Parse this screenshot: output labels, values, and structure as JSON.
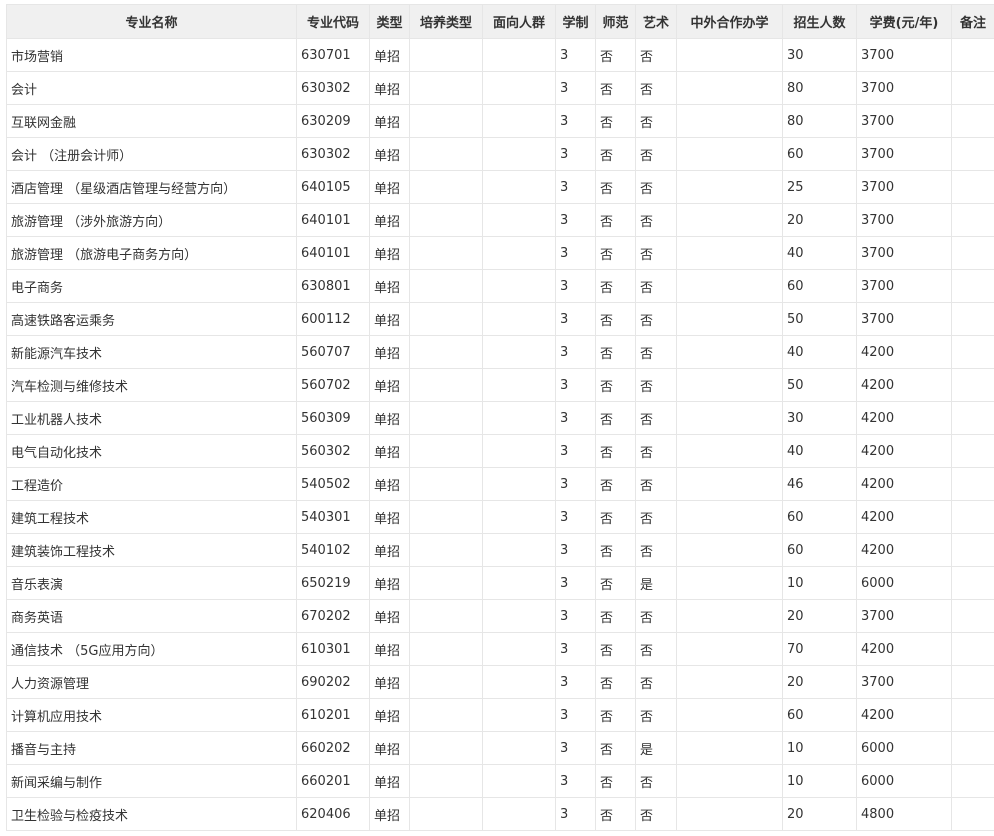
{
  "table": {
    "headers": [
      "专业名称",
      "专业代码",
      "类型",
      "培养类型",
      "面向人群",
      "学制",
      "师范",
      "艺术",
      "中外合作办学",
      "招生人数",
      "学费(元/年)",
      "备注"
    ],
    "rows": [
      [
        "市场营销",
        "630701",
        "单招",
        "",
        "",
        "3",
        "否",
        "否",
        "",
        "30",
        "3700",
        ""
      ],
      [
        "会计",
        "630302",
        "单招",
        "",
        "",
        "3",
        "否",
        "否",
        "",
        "80",
        "3700",
        ""
      ],
      [
        "互联网金融",
        "630209",
        "单招",
        "",
        "",
        "3",
        "否",
        "否",
        "",
        "80",
        "3700",
        ""
      ],
      [
        "会计 （注册会计师）",
        "630302",
        "单招",
        "",
        "",
        "3",
        "否",
        "否",
        "",
        "60",
        "3700",
        ""
      ],
      [
        "酒店管理 （星级酒店管理与经营方向）",
        "640105",
        "单招",
        "",
        "",
        "3",
        "否",
        "否",
        "",
        "25",
        "3700",
        ""
      ],
      [
        "旅游管理 （涉外旅游方向）",
        "640101",
        "单招",
        "",
        "",
        "3",
        "否",
        "否",
        "",
        "20",
        "3700",
        ""
      ],
      [
        "旅游管理 （旅游电子商务方向）",
        "640101",
        "单招",
        "",
        "",
        "3",
        "否",
        "否",
        "",
        "40",
        "3700",
        ""
      ],
      [
        "电子商务",
        "630801",
        "单招",
        "",
        "",
        "3",
        "否",
        "否",
        "",
        "60",
        "3700",
        ""
      ],
      [
        "高速铁路客运乘务",
        "600112",
        "单招",
        "",
        "",
        "3",
        "否",
        "否",
        "",
        "50",
        "3700",
        ""
      ],
      [
        "新能源汽车技术",
        "560707",
        "单招",
        "",
        "",
        "3",
        "否",
        "否",
        "",
        "40",
        "4200",
        ""
      ],
      [
        "汽车检测与维修技术",
        "560702",
        "单招",
        "",
        "",
        "3",
        "否",
        "否",
        "",
        "50",
        "4200",
        ""
      ],
      [
        "工业机器人技术",
        "560309",
        "单招",
        "",
        "",
        "3",
        "否",
        "否",
        "",
        "30",
        "4200",
        ""
      ],
      [
        "电气自动化技术",
        "560302",
        "单招",
        "",
        "",
        "3",
        "否",
        "否",
        "",
        "40",
        "4200",
        ""
      ],
      [
        "工程造价",
        "540502",
        "单招",
        "",
        "",
        "3",
        "否",
        "否",
        "",
        "46",
        "4200",
        ""
      ],
      [
        "建筑工程技术",
        "540301",
        "单招",
        "",
        "",
        "3",
        "否",
        "否",
        "",
        "60",
        "4200",
        ""
      ],
      [
        "建筑装饰工程技术",
        "540102",
        "单招",
        "",
        "",
        "3",
        "否",
        "否",
        "",
        "60",
        "4200",
        ""
      ],
      [
        "音乐表演",
        "650219",
        "单招",
        "",
        "",
        "3",
        "否",
        "是",
        "",
        "10",
        "6000",
        ""
      ],
      [
        "商务英语",
        "670202",
        "单招",
        "",
        "",
        "3",
        "否",
        "否",
        "",
        "20",
        "3700",
        ""
      ],
      [
        "通信技术 （5G应用方向）",
        "610301",
        "单招",
        "",
        "",
        "3",
        "否",
        "否",
        "",
        "70",
        "4200",
        ""
      ],
      [
        "人力资源管理",
        "690202",
        "单招",
        "",
        "",
        "3",
        "否",
        "否",
        "",
        "20",
        "3700",
        ""
      ],
      [
        "计算机应用技术",
        "610201",
        "单招",
        "",
        "",
        "3",
        "否",
        "否",
        "",
        "60",
        "4200",
        ""
      ],
      [
        "播音与主持",
        "660202",
        "单招",
        "",
        "",
        "3",
        "否",
        "是",
        "",
        "10",
        "6000",
        ""
      ],
      [
        "新闻采编与制作",
        "660201",
        "单招",
        "",
        "",
        "3",
        "否",
        "否",
        "",
        "10",
        "6000",
        ""
      ],
      [
        "卫生检验与检疫技术",
        "620406",
        "单招",
        "",
        "",
        "3",
        "否",
        "否",
        "",
        "20",
        "4800",
        ""
      ]
    ]
  }
}
